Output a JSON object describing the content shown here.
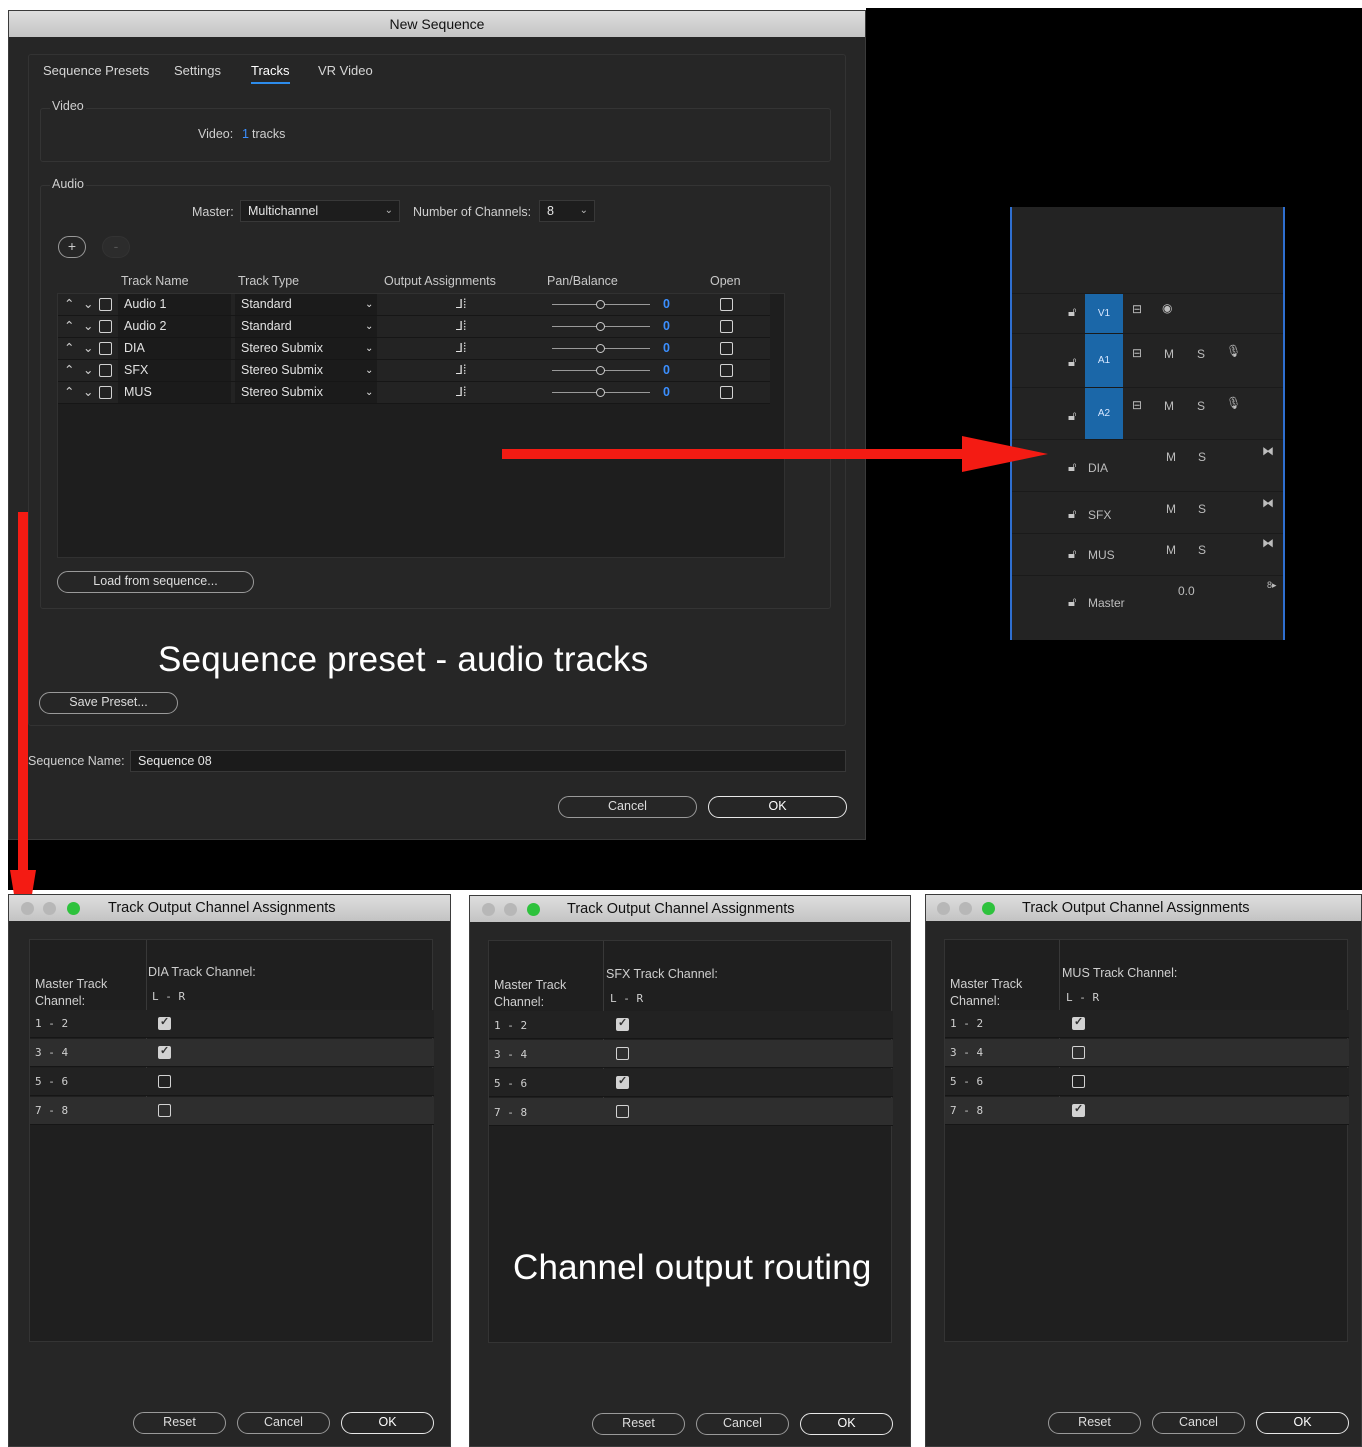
{
  "new_sequence": {
    "title": "New Sequence",
    "tabs": [
      "Sequence Presets",
      "Settings",
      "Tracks",
      "VR Video"
    ],
    "video": {
      "group_label": "Video",
      "label": "Video:",
      "count": "1",
      "unit": "tracks"
    },
    "audio": {
      "group_label": "Audio",
      "master_label": "Master:",
      "master_value": "Multichannel",
      "channels_label": "Number of Channels:",
      "channels_value": "8",
      "add_label": "+",
      "remove_label": "-",
      "columns": [
        "Track Name",
        "Track Type",
        "Output Assignments",
        "Pan/Balance",
        "Open"
      ],
      "tracks": [
        {
          "name": "Audio 1",
          "type": "Standard",
          "pan": "0"
        },
        {
          "name": "Audio 2",
          "type": "Standard",
          "pan": "0"
        },
        {
          "name": "DIA",
          "type": "Stereo Submix",
          "pan": "0"
        },
        {
          "name": "SFX",
          "type": "Stereo Submix",
          "pan": "0"
        },
        {
          "name": "MUS",
          "type": "Stereo Submix",
          "pan": "0"
        }
      ],
      "load_button": "Load from sequence..."
    },
    "save_preset": "Save Preset...",
    "seq_name_label": "Sequence Name:",
    "seq_name_value": "Sequence 08",
    "cancel": "Cancel",
    "ok": "OK"
  },
  "captions": {
    "preset": "Sequence preset - audio tracks",
    "routing": "Channel output routing"
  },
  "timeline": {
    "tracks": [
      {
        "label": "V1",
        "buttons": [
          "",
          ""
        ]
      },
      {
        "label": "A1",
        "m": "M",
        "s": "S"
      },
      {
        "label": "A2",
        "m": "M",
        "s": "S"
      },
      {
        "label": "DIA",
        "m": "M",
        "s": "S"
      },
      {
        "label": "SFX",
        "m": "M",
        "s": "S"
      },
      {
        "label": "MUS",
        "m": "M",
        "s": "S"
      },
      {
        "label": "Master",
        "value": "0.0"
      }
    ]
  },
  "channel_windows": [
    {
      "title": "Track Output Channel Assignments",
      "master_label": "Master Track Channel:",
      "track_label": "DIA Track Channel:",
      "lr": "L - R",
      "rows": [
        {
          "ch": "1 - 2",
          "checked": true
        },
        {
          "ch": "3 - 4",
          "checked": true
        },
        {
          "ch": "5 - 6",
          "checked": false
        },
        {
          "ch": "7 - 8",
          "checked": false
        }
      ],
      "reset": "Reset",
      "cancel": "Cancel",
      "ok": "OK"
    },
    {
      "title": "Track Output Channel Assignments",
      "master_label": "Master Track Channel:",
      "track_label": "SFX Track Channel:",
      "lr": "L - R",
      "rows": [
        {
          "ch": "1 - 2",
          "checked": true
        },
        {
          "ch": "3 - 4",
          "checked": false
        },
        {
          "ch": "5 - 6",
          "checked": true
        },
        {
          "ch": "7 - 8",
          "checked": false
        }
      ],
      "reset": "Reset",
      "cancel": "Cancel",
      "ok": "OK"
    },
    {
      "title": "Track Output Channel Assignments",
      "master_label": "Master Track Channel:",
      "track_label": "MUS Track Channel:",
      "lr": "L - R",
      "rows": [
        {
          "ch": "1 - 2",
          "checked": true
        },
        {
          "ch": "3 - 4",
          "checked": false
        },
        {
          "ch": "5 - 6",
          "checked": false
        },
        {
          "ch": "7 - 8",
          "checked": true
        }
      ],
      "reset": "Reset",
      "cancel": "Cancel",
      "ok": "OK"
    }
  ],
  "colors": {
    "accent": "#2d8ceb",
    "arrow": "#f41b13",
    "track_blue": "#1b67a8"
  }
}
